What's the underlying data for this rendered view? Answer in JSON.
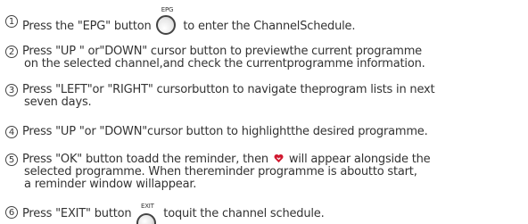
{
  "steps": [
    {
      "number": "1",
      "before": "Press the \"EPG\" button",
      "button_label": "EPG",
      "after": "to enter the ChannelSchedule."
    },
    {
      "number": "2",
      "line1": "Press \"UP \" or\"DOWN\" cursor  button to previewthe current programme",
      "line2": "on the selected channel,and check the currentprogramme information."
    },
    {
      "number": "3",
      "line1": "Press \"LEFT\"or \"RIGHT\" cursorbutton to navigate theprogram lists in next",
      "line2": "seven days."
    },
    {
      "number": "4",
      "line1": "Press \"UP \"or \"DOWN\"cursor button to highlightthe desired programme."
    },
    {
      "number": "5",
      "line1_before": "Press \"OK\" button toadd the reminder, then",
      "line1_after": "will appear alongside the",
      "line2": "selected programme. When thereminder programme is aboutto start,",
      "line3": "a reminder window willappear.",
      "icon": "reminder-heart-icon",
      "icon_color": "#d0182f"
    },
    {
      "number": "6",
      "before": "Press \"EXIT\" button",
      "button_label": "EXIT",
      "after": "toquit the channel schedule."
    }
  ]
}
